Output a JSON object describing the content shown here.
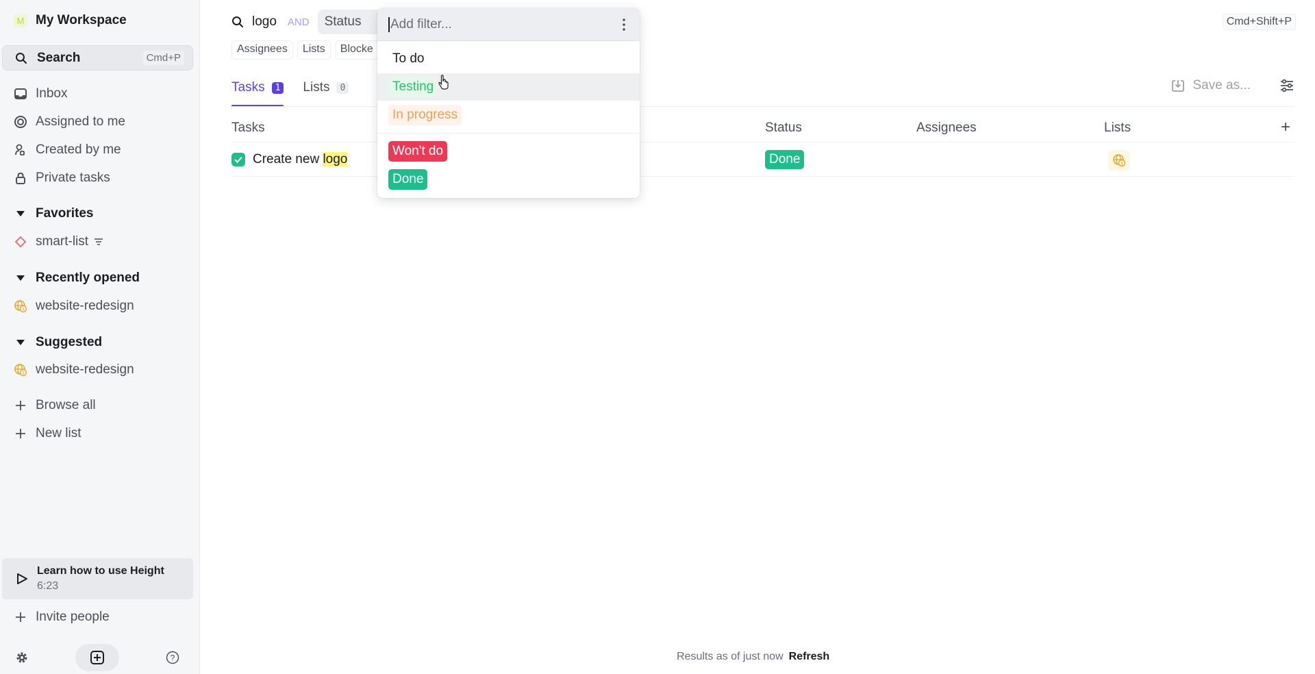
{
  "sidebar": {
    "workspace": {
      "initial": "M",
      "name": "My Workspace"
    },
    "search": {
      "label": "Search",
      "shortcut": "Cmd+P"
    },
    "nav": [
      {
        "label": "Inbox",
        "icon": "inbox-icon"
      },
      {
        "label": "Assigned to me",
        "icon": "target-icon"
      },
      {
        "label": "Created by me",
        "icon": "user-created-icon"
      },
      {
        "label": "Private tasks",
        "icon": "lock-icon"
      }
    ],
    "sections": {
      "favorites": {
        "title": "Favorites",
        "items": [
          {
            "label": "smart-list",
            "icon": "diamond-icon",
            "badge_icon": "filter-icon"
          }
        ]
      },
      "recent": {
        "title": "Recently opened",
        "items": [
          {
            "label": "website-redesign",
            "icon": "globe-dollar-icon"
          }
        ]
      },
      "suggested": {
        "title": "Suggested",
        "items": [
          {
            "label": "website-redesign",
            "icon": "globe-dollar-icon"
          }
        ]
      }
    },
    "browse_all": "Browse all",
    "new_list": "New list",
    "learn": {
      "title": "Learn how to use Height",
      "duration": "6:23"
    },
    "invite": "Invite people"
  },
  "search_bar": {
    "term": "logo",
    "operator": "AND",
    "filter_chip": "Status",
    "shortcut": "Cmd+Shift+P",
    "fields": [
      "Assignees",
      "Lists",
      "Blocke"
    ]
  },
  "tabs": [
    {
      "label": "Tasks",
      "count": "1",
      "active": true
    },
    {
      "label": "Lists",
      "count": "0",
      "active": false
    }
  ],
  "toolbar": {
    "save_label": "Save as..."
  },
  "table": {
    "columns": [
      "Tasks",
      "Status",
      "Assignees",
      "Lists"
    ],
    "rows": [
      {
        "title_prefix": "Create new ",
        "title_highlight": "logo",
        "done": true,
        "status": "Done",
        "assignees": "",
        "list_icon": "globe-dollar-icon"
      }
    ]
  },
  "dropdown": {
    "placeholder": "Add filter...",
    "options": [
      {
        "label": "To do",
        "color": "#1c1d21"
      },
      {
        "label": "Testing",
        "color": "#27c46b",
        "hovered": true
      },
      {
        "label": "In progress",
        "color": "#eaa25a"
      },
      {
        "label": "Won't do",
        "color": "#ea3a56"
      },
      {
        "label": "Done",
        "color": "#1dbd8c"
      }
    ]
  },
  "footer": {
    "status": "Results as of just now",
    "refresh": "Refresh"
  }
}
